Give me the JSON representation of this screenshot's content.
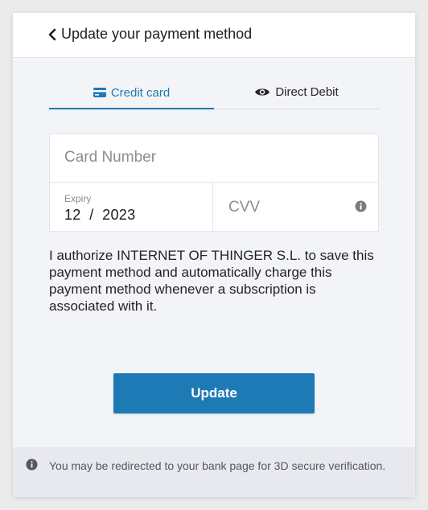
{
  "header": {
    "back_label": "Update your payment method"
  },
  "tabs": [
    {
      "label": "Credit card",
      "active": true
    },
    {
      "label": "Direct Debit",
      "active": false
    }
  ],
  "form": {
    "card_number_placeholder": "Card Number",
    "expiry_label": "Expiry",
    "expiry_month": "12",
    "expiry_separator": "/",
    "expiry_year": "2023",
    "cvv_placeholder": "CVV"
  },
  "authorization_text": "I authorize INTERNET OF THINGER S.L. to save this payment method and automatically charge this payment method whenever a subscription is associated with it.",
  "update_button_label": "Update",
  "footer": {
    "notice": "You may be redirected to your bank page for 3D secure verification."
  },
  "colors": {
    "accent": "#1d7ab5",
    "background": "#f3f4f8",
    "footer": "#e8e9ee"
  },
  "icons": {
    "back": "chevron-left-icon",
    "credit_card": "credit-card-icon",
    "direct_debit": "eye-icon",
    "info": "info-icon"
  }
}
